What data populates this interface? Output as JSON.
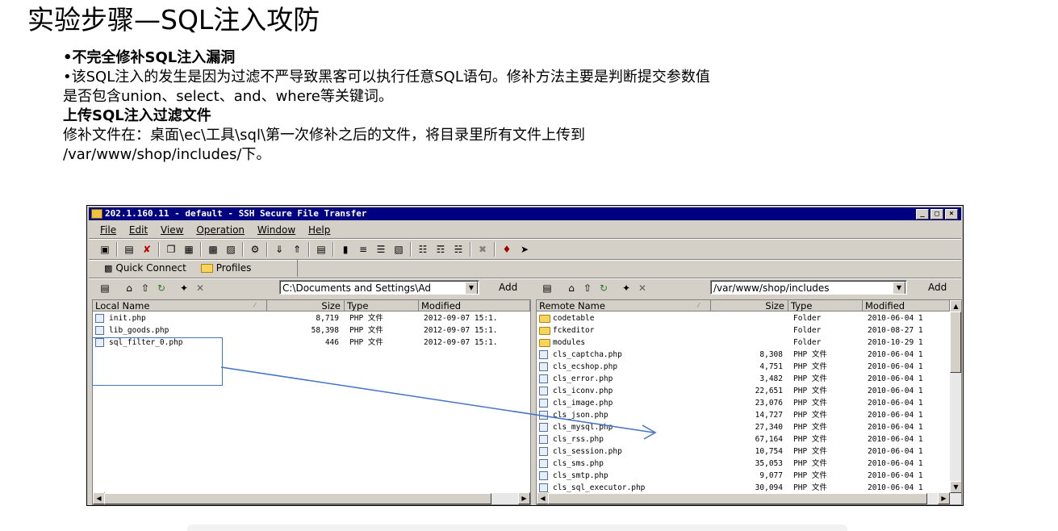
{
  "slide": {
    "title": "实验步骤—SQL注入攻防",
    "lines": [
      "•不完全修补SQL注入漏洞",
      "•该SQL注入的发生是因为过滤不严导致黑客可以执行任意SQL语句。修补方法主要是判断提交参数值",
      "是否包含union、select、and、where等关键词。",
      "上传SQL注入过滤文件",
      "修补文件在：桌面\\ec\\工具\\sql\\第一次修补之后的文件，将目录里所有文件上传到",
      "/var/www/shop/includes/下。"
    ]
  },
  "window": {
    "title": "202.1.160.11 - default - SSH Secure File Transfer",
    "buttons": [
      "_",
      "□",
      "×"
    ],
    "menu": [
      "File",
      "Edit",
      "View",
      "Operation",
      "Window",
      "Help"
    ],
    "quick_connect": "Quick Connect",
    "profiles": "Profiles",
    "local_path": "C:\\Documents and Settings\\Ad",
    "remote_path": "/var/www/shop/includes",
    "add_label": "Add"
  },
  "local_pane": {
    "headers": [
      "Local Name",
      "Size",
      "Type",
      "Modified"
    ],
    "rows": [
      {
        "name": "init.php",
        "size": "8,719",
        "type": "PHP 文件",
        "modified": "2012-09-07 15:1."
      },
      {
        "name": "lib_goods.php",
        "size": "58,398",
        "type": "PHP 文件",
        "modified": "2012-09-07 15:1."
      },
      {
        "name": "sql_filter_0.php",
        "size": "446",
        "type": "PHP 文件",
        "modified": "2012-09-07 15:1."
      }
    ]
  },
  "remote_pane": {
    "headers": [
      "Remote Name",
      "Size",
      "Type",
      "Modified"
    ],
    "rows": [
      {
        "name": "codetable",
        "size": "",
        "type": "Folder",
        "modified": "2010-06-04 1",
        "folder": true
      },
      {
        "name": "fckeditor",
        "size": "",
        "type": "Folder",
        "modified": "2010-08-27 1",
        "folder": true
      },
      {
        "name": "modules",
        "size": "",
        "type": "Folder",
        "modified": "2010-10-29 1",
        "folder": true
      },
      {
        "name": "cls_captcha.php",
        "size": "8,308",
        "type": "PHP 文件",
        "modified": "2010-06-04 1"
      },
      {
        "name": "cls_ecshop.php",
        "size": "4,751",
        "type": "PHP 文件",
        "modified": "2010-06-04 1"
      },
      {
        "name": "cls_error.php",
        "size": "3,482",
        "type": "PHP 文件",
        "modified": "2010-06-04 1"
      },
      {
        "name": "cls_iconv.php",
        "size": "22,651",
        "type": "PHP 文件",
        "modified": "2010-06-04 1"
      },
      {
        "name": "cls_image.php",
        "size": "23,076",
        "type": "PHP 文件",
        "modified": "2010-06-04 1"
      },
      {
        "name": "cls_json.php",
        "size": "14,727",
        "type": "PHP 文件",
        "modified": "2010-06-04 1"
      },
      {
        "name": "cls_mysql.php",
        "size": "27,340",
        "type": "PHP 文件",
        "modified": "2010-06-04 1"
      },
      {
        "name": "cls_rss.php",
        "size": "67,164",
        "type": "PHP 文件",
        "modified": "2010-06-04 1"
      },
      {
        "name": "cls_session.php",
        "size": "10,754",
        "type": "PHP 文件",
        "modified": "2010-06-04 1"
      },
      {
        "name": "cls_sms.php",
        "size": "35,053",
        "type": "PHP 文件",
        "modified": "2010-06-04 1"
      },
      {
        "name": "cls_smtp.php",
        "size": "9,077",
        "type": "PHP 文件",
        "modified": "2010-06-04 1"
      },
      {
        "name": "cls_sql_executor.php",
        "size": "30,094",
        "type": "PHP 文件",
        "modified": "2010-06-04 1"
      }
    ]
  },
  "colors": {
    "titlebar": "#000080",
    "annotation": "#4472c4",
    "window_bg": "#d4d0c8"
  }
}
